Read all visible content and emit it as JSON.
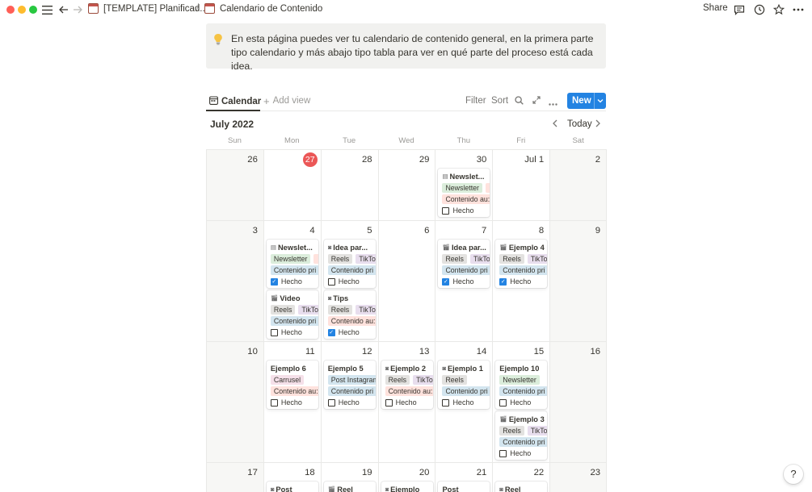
{
  "topbar": {
    "breadcrumb_parent": "[TEMPLATE] Planificad...",
    "breadcrumb_sep": "/",
    "breadcrumb_current": "Calendario de Contenido",
    "share_label": "Share"
  },
  "callout": {
    "icon": "lightbulb-icon",
    "text": "En esta página puedes ver tu calendario de contenido general, en la primera parte tipo calendario y más abajo tipo tabla para ver en qué parte del proceso está cada idea."
  },
  "view": {
    "tab_label": "Calendar",
    "add_view_label": "Add view",
    "filter_label": "Filter",
    "sort_label": "Sort",
    "new_label": "New"
  },
  "calendar": {
    "month_label": "July 2022",
    "today_label": "Today",
    "weekdays": [
      "Sun",
      "Mon",
      "Tue",
      "Wed",
      "Thu",
      "Fri",
      "Sat"
    ],
    "weeks": [
      {
        "days": [
          {
            "num": "26",
            "weekend": true,
            "cards": []
          },
          {
            "num": "27",
            "today": true,
            "cards": []
          },
          {
            "num": "28",
            "cards": []
          },
          {
            "num": "29",
            "cards": []
          },
          {
            "num": "30",
            "cards": [
              {
                "icon": "doc",
                "title": "Newslet...",
                "tags": [
                  {
                    "t": "Newsletter",
                    "c": "green"
                  },
                  {
                    "t": "",
                    "c": "red"
                  }
                ],
                "status": {
                  "t": "Contenido au:",
                  "c": "red"
                },
                "check": "Hecho",
                "done": false
              }
            ]
          },
          {
            "num": "Jul 1",
            "cards": []
          },
          {
            "num": "2",
            "weekend": true,
            "cards": []
          }
        ]
      },
      {
        "days": [
          {
            "num": "3",
            "weekend": true,
            "cards": []
          },
          {
            "num": "4",
            "cards": [
              {
                "icon": "doc",
                "title": "Newslet...",
                "tags": [
                  {
                    "t": "Newsletter",
                    "c": "green"
                  },
                  {
                    "t": "",
                    "c": "red"
                  }
                ],
                "status": {
                  "t": "Contenido pri",
                  "c": "blue"
                },
                "check": "Hecho",
                "done": true
              },
              {
                "icon": "clap",
                "title": "Video",
                "tags": [
                  {
                    "t": "Reels",
                    "c": "gray"
                  },
                  {
                    "t": "TikTo",
                    "c": "purple"
                  }
                ],
                "status": {
                  "t": "Contenido pri",
                  "c": "blue"
                },
                "check": "Hecho",
                "done": false
              }
            ]
          },
          {
            "num": "5",
            "cards": [
              {
                "icon": "cam",
                "title": "Idea par...",
                "tags": [
                  {
                    "t": "Reels",
                    "c": "gray"
                  },
                  {
                    "t": "TikTo",
                    "c": "purple"
                  }
                ],
                "status": {
                  "t": "Contenido pri",
                  "c": "blue"
                },
                "check": "Hecho",
                "done": false
              },
              {
                "icon": "cam",
                "title": "Tips",
                "tags": [
                  {
                    "t": "Reels",
                    "c": "gray"
                  },
                  {
                    "t": "TikTo",
                    "c": "purple"
                  }
                ],
                "status": {
                  "t": "Contenido au:",
                  "c": "red"
                },
                "check": "Hecho",
                "done": true
              }
            ]
          },
          {
            "num": "6",
            "cards": []
          },
          {
            "num": "7",
            "cards": [
              {
                "icon": "clap",
                "title": "Idea par...",
                "tags": [
                  {
                    "t": "Reels",
                    "c": "gray"
                  },
                  {
                    "t": "TikTo",
                    "c": "purple"
                  }
                ],
                "status": {
                  "t": "Contenido pri",
                  "c": "blue"
                },
                "check": "Hecho",
                "done": true
              }
            ]
          },
          {
            "num": "8",
            "cards": [
              {
                "icon": "clap",
                "title": "Ejemplo 4",
                "tags": [
                  {
                    "t": "Reels",
                    "c": "gray"
                  },
                  {
                    "t": "TikTo",
                    "c": "purple"
                  }
                ],
                "status": {
                  "t": "Contenido pri",
                  "c": "blue"
                },
                "check": "Hecho",
                "done": true
              }
            ]
          },
          {
            "num": "9",
            "weekend": true,
            "cards": []
          }
        ]
      },
      {
        "days": [
          {
            "num": "10",
            "weekend": true,
            "cards": []
          },
          {
            "num": "11",
            "cards": [
              {
                "icon": "",
                "title": "Ejemplo 6",
                "tags": [
                  {
                    "t": "Carrusel",
                    "c": "pink"
                  }
                ],
                "status": {
                  "t": "Contenido au:",
                  "c": "red"
                },
                "check": "Hecho",
                "done": false
              }
            ]
          },
          {
            "num": "12",
            "cards": [
              {
                "icon": "",
                "title": "Ejemplo 5",
                "tags": [
                  {
                    "t": "Post Instagram",
                    "c": "blue"
                  }
                ],
                "status": {
                  "t": "Contenido pri",
                  "c": "blue"
                },
                "check": "Hecho",
                "done": false
              }
            ]
          },
          {
            "num": "13",
            "cards": [
              {
                "icon": "cam",
                "title": "Ejemplo 2",
                "tags": [
                  {
                    "t": "Reels",
                    "c": "gray"
                  },
                  {
                    "t": "TikTo",
                    "c": "purple"
                  }
                ],
                "status": {
                  "t": "Contenido au:",
                  "c": "red"
                },
                "check": "Hecho",
                "done": false
              }
            ]
          },
          {
            "num": "14",
            "cards": [
              {
                "icon": "cam",
                "title": "Ejemplo 1",
                "tags": [
                  {
                    "t": "Reels",
                    "c": "gray"
                  }
                ],
                "status": {
                  "t": "Contenido pri",
                  "c": "blue"
                },
                "check": "Hecho",
                "done": false
              }
            ]
          },
          {
            "num": "15",
            "cards": [
              {
                "icon": "",
                "title": "Ejemplo 10",
                "tags": [
                  {
                    "t": "Newsletter",
                    "c": "green"
                  }
                ],
                "status": {
                  "t": "Contenido pri",
                  "c": "blue"
                },
                "check": "Hecho",
                "done": false
              },
              {
                "icon": "clap",
                "title": "Ejemplo 3",
                "tags": [
                  {
                    "t": "Reels",
                    "c": "gray"
                  },
                  {
                    "t": "TikTo",
                    "c": "purple"
                  }
                ],
                "status": {
                  "t": "Contenido pri",
                  "c": "blue"
                },
                "check": "Hecho",
                "done": false
              }
            ]
          },
          {
            "num": "16",
            "weekend": true,
            "cards": []
          }
        ]
      },
      {
        "days": [
          {
            "num": "17",
            "weekend": true,
            "cards": []
          },
          {
            "num": "18",
            "cards": [
              {
                "icon": "cam",
                "title": "Post",
                "tags": [],
                "status": null,
                "check": "",
                "done": false
              }
            ]
          },
          {
            "num": "19",
            "cards": [
              {
                "icon": "clap",
                "title": "Reel",
                "tags": [],
                "status": null,
                "check": "",
                "done": false
              }
            ]
          },
          {
            "num": "20",
            "cards": [
              {
                "icon": "cam",
                "title": "Ejemplo",
                "tags": [],
                "status": null,
                "check": "",
                "done": false
              }
            ]
          },
          {
            "num": "21",
            "cards": [
              {
                "icon": "",
                "title": "Post",
                "tags": [],
                "status": null,
                "check": "",
                "done": false
              }
            ]
          },
          {
            "num": "22",
            "cards": [
              {
                "icon": "cam",
                "title": "Reel",
                "tags": [],
                "status": null,
                "check": "",
                "done": false
              }
            ]
          },
          {
            "num": "23",
            "weekend": true,
            "cards": []
          }
        ]
      }
    ]
  },
  "colors": {
    "accent": "#2383e2",
    "today": "#eb5757",
    "tag_green": "#dbeddb",
    "tag_red": "#ffe2dd",
    "tag_blue": "#d3e5ef",
    "tag_gray": "#e3e2e0",
    "tag_purple": "#e8deee",
    "tag_pink": "#f5e0e9"
  }
}
